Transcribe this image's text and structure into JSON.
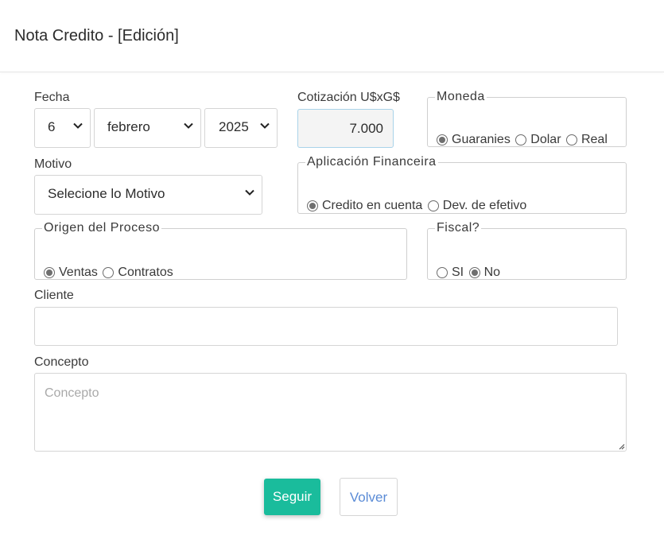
{
  "header": {
    "title": "Nota Credito - [Edición]"
  },
  "form": {
    "fecha": {
      "label": "Fecha",
      "day": "6",
      "month": "febrero",
      "year": "2025"
    },
    "cotizacion": {
      "label": "Cotización U$xG$",
      "value": "7.000"
    },
    "moneda": {
      "legend": "Moneda",
      "options": [
        "Guaranies",
        "Dolar",
        "Real"
      ],
      "selected": "Guaranies"
    },
    "motivo": {
      "label": "Motivo",
      "value": "Selecione lo Motivo"
    },
    "aplicacion": {
      "legend": "Aplicación Financeira",
      "options": [
        "Credito en cuenta",
        "Dev. de efetivo"
      ],
      "selected": "Credito en cuenta"
    },
    "origen": {
      "legend": "Origen del Proceso",
      "options": [
        "Ventas",
        "Contratos"
      ],
      "selected": "Ventas"
    },
    "fiscal": {
      "legend": "Fiscal?",
      "options": [
        "SI",
        "No"
      ],
      "selected": "No"
    },
    "cliente": {
      "label": "Cliente",
      "value": ""
    },
    "concepto": {
      "label": "Concepto",
      "placeholder": "Concepto",
      "value": ""
    }
  },
  "buttons": {
    "seguir": "Seguir",
    "volver": "Volver"
  },
  "colors": {
    "primary": "#1abc9c",
    "link": "#5a8bd6",
    "border": "#d5d5d5"
  }
}
